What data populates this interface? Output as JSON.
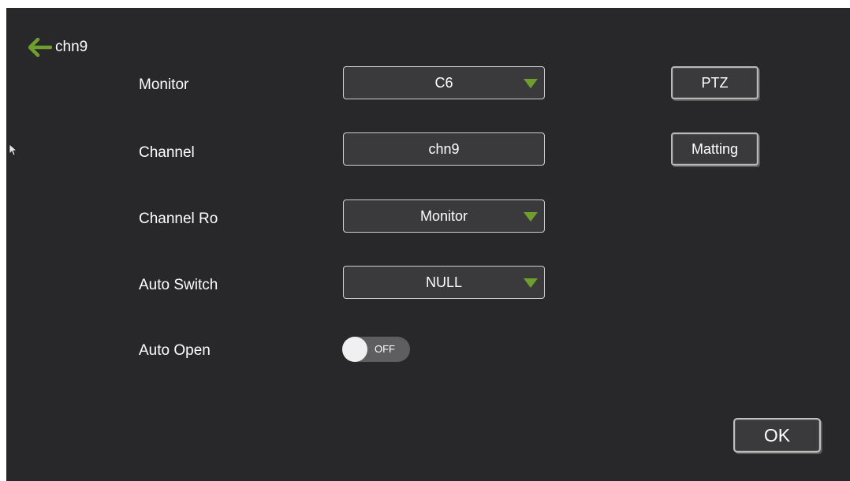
{
  "header": {
    "title": "chn9",
    "back_icon": "left-arrow-icon",
    "accent_color": "#6e9e2e"
  },
  "rows": [
    {
      "label": "Monitor",
      "value": "C6",
      "kind": "dropdown"
    },
    {
      "label": "Channel",
      "value": "chn9",
      "kind": "text"
    },
    {
      "label": "Channel Ro",
      "value": "Monitor",
      "kind": "dropdown"
    },
    {
      "label": "Auto Switch",
      "value": "NULL",
      "kind": "dropdown"
    },
    {
      "label": "Auto Open",
      "value": "OFF",
      "kind": "toggle",
      "state": "off"
    }
  ],
  "side_buttons": {
    "ptz_label": "PTZ",
    "matting_label": "Matting"
  },
  "footer": {
    "ok_label": "OK"
  },
  "colors": {
    "background": "#28282a",
    "field": "#3a3a3c",
    "caret": "#6e9e2e"
  }
}
